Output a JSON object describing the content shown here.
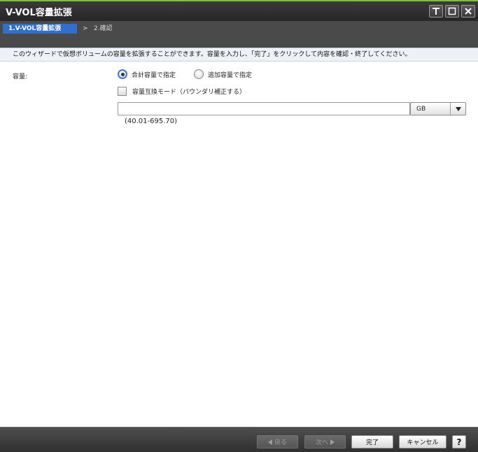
{
  "window": {
    "title": "V-VOL容量拡張",
    "buttons": [
      "restore-icon",
      "maximize-icon",
      "close-icon"
    ]
  },
  "steps": {
    "current": "1.V-VOL容量拡張",
    "separator": ">",
    "next": "2.確認"
  },
  "description": "このウィザードで仮想ボリュームの容量を拡張することができます。容量を入力し、「完了」をクリックして内容を確認・終了してください。",
  "form": {
    "capacity_label": "容量:",
    "radio_total": "合計容量で指定",
    "radio_total_checked": true,
    "radio_add": "追加容量で指定",
    "radio_add_checked": false,
    "compat_checkbox_label": "容量互換モード（バウンダリ補正する）",
    "compat_checked": false,
    "capacity_value": "",
    "unit_selected": "GB",
    "range_hint": "(40.01-695.70)"
  },
  "footer": {
    "back": "戻る",
    "next": "次へ",
    "finish": "完了",
    "cancel": "キャンセル",
    "help": "?"
  },
  "colors": {
    "title_accent": "#7cbf3a",
    "step_active": "#2f6fd0",
    "radio_focus": "#3a7be0"
  }
}
